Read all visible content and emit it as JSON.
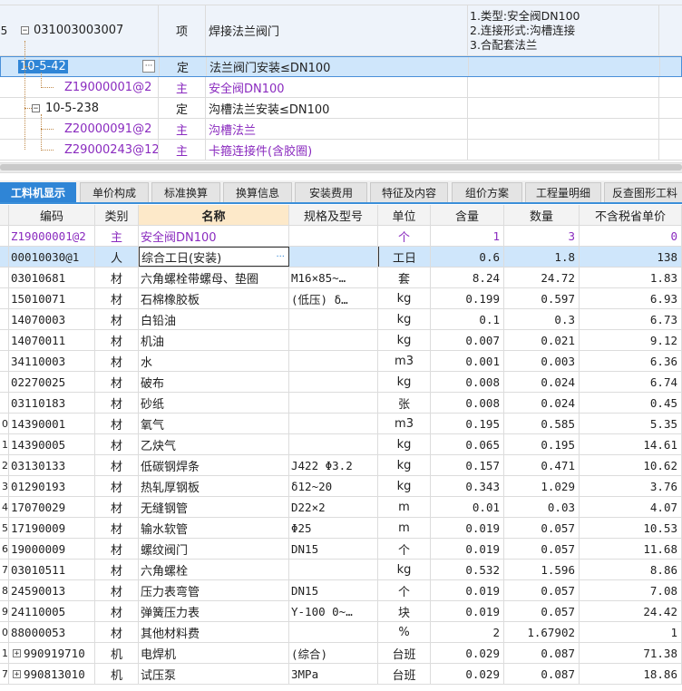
{
  "upper_grid": {
    "rows": [
      {
        "line_no": "5",
        "code": "031003003007",
        "kind": "项",
        "name": "焊接法兰阀门",
        "features": [
          "1.类型:安全阀DN100",
          "2.连接形式:沟槽连接",
          "3.合配套法兰"
        ],
        "color": "normal"
      },
      {
        "line_no": "",
        "code": "10-5-42",
        "kind": "定",
        "name": "法兰阀门安装≤DN100",
        "features": [],
        "color": "normal",
        "selected": true
      },
      {
        "line_no": "",
        "code": "Z19000001@2",
        "kind": "主",
        "name": "安全阀DN100",
        "features": [],
        "color": "purple"
      },
      {
        "line_no": "",
        "code": "10-5-238",
        "kind": "定",
        "name": "沟槽法兰安装≤DN100",
        "features": [],
        "color": "normal"
      },
      {
        "line_no": "",
        "code": "Z20000091@2",
        "kind": "主",
        "name": "沟槽法兰",
        "features": [],
        "color": "purple"
      },
      {
        "line_no": "",
        "code": "Z29000243@12",
        "kind": "主",
        "name": "卡箍连接件(含胶圈)",
        "features": [],
        "color": "purple"
      }
    ],
    "ellipsis_label": "···"
  },
  "tabs": [
    "工料机显示",
    "单价构成",
    "标准换算",
    "换算信息",
    "安装费用",
    "特征及内容",
    "组价方案",
    "工程量明细",
    "反查图形工料"
  ],
  "lower_grid": {
    "headers": [
      "编码",
      "类别",
      "名称",
      "规格及型号",
      "单位",
      "含量",
      "数量",
      "不含税省单价"
    ],
    "rows": [
      {
        "idx": "",
        "code": "Z19000001@2",
        "type": "主",
        "name": "安全阀DN100",
        "spec": "",
        "unit": "个",
        "content": "1",
        "qty": "3",
        "price": "0",
        "color": "purple"
      },
      {
        "idx": "",
        "code": "00010030@1",
        "type": "人",
        "name": "综合工日(安装)",
        "spec": "",
        "unit": "工日",
        "content": "0.6",
        "qty": "1.8",
        "price": "138",
        "selected": true
      },
      {
        "idx": "",
        "code": "03010681",
        "type": "材",
        "name": "六角螺栓带螺母、垫圈",
        "spec": "M16×85~…",
        "unit": "套",
        "content": "8.24",
        "qty": "24.72",
        "price": "1.83"
      },
      {
        "idx": "",
        "code": "15010071",
        "type": "材",
        "name": "石棉橡胶板",
        "spec": "(低压) δ…",
        "unit": "kg",
        "content": "0.199",
        "qty": "0.597",
        "price": "6.93"
      },
      {
        "idx": "",
        "code": "14070003",
        "type": "材",
        "name": "白铅油",
        "spec": "",
        "unit": "kg",
        "content": "0.1",
        "qty": "0.3",
        "price": "6.73"
      },
      {
        "idx": "",
        "code": "14070011",
        "type": "材",
        "name": "机油",
        "spec": "",
        "unit": "kg",
        "content": "0.007",
        "qty": "0.021",
        "price": "9.12"
      },
      {
        "idx": "",
        "code": "34110003",
        "type": "材",
        "name": "水",
        "spec": "",
        "unit": "m3",
        "content": "0.001",
        "qty": "0.003",
        "price": "6.36"
      },
      {
        "idx": "",
        "code": "02270025",
        "type": "材",
        "name": "破布",
        "spec": "",
        "unit": "kg",
        "content": "0.008",
        "qty": "0.024",
        "price": "6.74"
      },
      {
        "idx": "",
        "code": "03110183",
        "type": "材",
        "name": "砂纸",
        "spec": "",
        "unit": "张",
        "content": "0.008",
        "qty": "0.024",
        "price": "0.45"
      },
      {
        "idx": "0",
        "code": "14390001",
        "type": "材",
        "name": "氧气",
        "spec": "",
        "unit": "m3",
        "content": "0.195",
        "qty": "0.585",
        "price": "5.35"
      },
      {
        "idx": "1",
        "code": "14390005",
        "type": "材",
        "name": "乙炔气",
        "spec": "",
        "unit": "kg",
        "content": "0.065",
        "qty": "0.195",
        "price": "14.61"
      },
      {
        "idx": "2",
        "code": "03130133",
        "type": "材",
        "name": "低碳钢焊条",
        "spec": "J422 Φ3.2",
        "unit": "kg",
        "content": "0.157",
        "qty": "0.471",
        "price": "10.62"
      },
      {
        "idx": "3",
        "code": "01290193",
        "type": "材",
        "name": "热轧厚钢板",
        "spec": "δ12~20",
        "unit": "kg",
        "content": "0.343",
        "qty": "1.029",
        "price": "3.76"
      },
      {
        "idx": "4",
        "code": "17070029",
        "type": "材",
        "name": "无缝钢管",
        "spec": "D22×2",
        "unit": "m",
        "content": "0.01",
        "qty": "0.03",
        "price": "4.07"
      },
      {
        "idx": "5",
        "code": "17190009",
        "type": "材",
        "name": "输水软管",
        "spec": "Φ25",
        "unit": "m",
        "content": "0.019",
        "qty": "0.057",
        "price": "10.53"
      },
      {
        "idx": "6",
        "code": "19000009",
        "type": "材",
        "name": "螺纹阀门",
        "spec": "DN15",
        "unit": "个",
        "content": "0.019",
        "qty": "0.057",
        "price": "11.68"
      },
      {
        "idx": "7",
        "code": "03010511",
        "type": "材",
        "name": "六角螺栓",
        "spec": "",
        "unit": "kg",
        "content": "0.532",
        "qty": "1.596",
        "price": "8.86"
      },
      {
        "idx": "8",
        "code": "24590013",
        "type": "材",
        "name": "压力表弯管",
        "spec": "DN15",
        "unit": "个",
        "content": "0.019",
        "qty": "0.057",
        "price": "7.08"
      },
      {
        "idx": "9",
        "code": "24110005",
        "type": "材",
        "name": "弹簧压力表",
        "spec": "Y-100 0~…",
        "unit": "块",
        "content": "0.019",
        "qty": "0.057",
        "price": "24.42"
      },
      {
        "idx": "0",
        "code": "88000053",
        "type": "材",
        "name": "其他材料费",
        "spec": "",
        "unit": "%",
        "content": "2",
        "qty": "1.67902",
        "price": "1"
      },
      {
        "idx": "1",
        "code": "990919710",
        "type": "机",
        "name": "电焊机",
        "spec": "(综合)",
        "unit": "台班",
        "content": "0.029",
        "qty": "0.087",
        "price": "71.38",
        "expandable": true
      },
      {
        "idx": "7",
        "code": "990813010",
        "type": "机",
        "name": "试压泵",
        "spec": "3MPa",
        "unit": "台班",
        "content": "0.029",
        "qty": "0.087",
        "price": "18.86",
        "expandable": true
      }
    ]
  },
  "colors": {
    "purple": "#8a2bbf",
    "selected_row": "#cfe6fb",
    "tab_active": "#2f85d6",
    "header_bg": "#e8f0fb"
  }
}
